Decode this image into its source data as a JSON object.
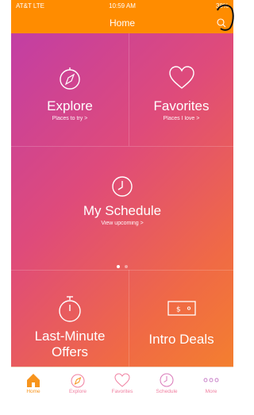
{
  "status_bar": {
    "carrier": "AT&T  LTE",
    "time": "10:59 AM",
    "battery": "38%"
  },
  "header": {
    "title": "Home",
    "search_icon": "search-icon"
  },
  "tiles": {
    "explore": {
      "title": "Explore",
      "subtitle": "Places to try >",
      "icon": "compass-icon"
    },
    "favorites": {
      "title": "Favorites",
      "subtitle": "Places I love >",
      "icon": "heart-icon"
    },
    "schedule": {
      "title": "My Schedule",
      "subtitle": "View upcoming >",
      "icon": "clock-icon"
    },
    "last_minute": {
      "title_line1": "Last-Minute",
      "title_line2": "Offers",
      "icon": "stopwatch-icon"
    },
    "intro_deals": {
      "title": "Intro Deals",
      "icon": "ticket-icon"
    }
  },
  "pager": {
    "pages": 2,
    "current": 1
  },
  "tab_bar": {
    "items": [
      {
        "label": "Home",
        "icon": "home-icon",
        "active": true
      },
      {
        "label": "Explore",
        "icon": "compass-icon",
        "active": false
      },
      {
        "label": "Favorites",
        "icon": "heart-icon",
        "active": false
      },
      {
        "label": "Schedule",
        "icon": "clock-icon",
        "active": false
      },
      {
        "label": "More",
        "icon": "more-icon",
        "active": false
      }
    ]
  },
  "colors": {
    "accent_orange": "#f7941d",
    "gradient_start": "#c23ea4",
    "gradient_end": "#f4822c",
    "tab_inactive": "#f07fa0"
  }
}
